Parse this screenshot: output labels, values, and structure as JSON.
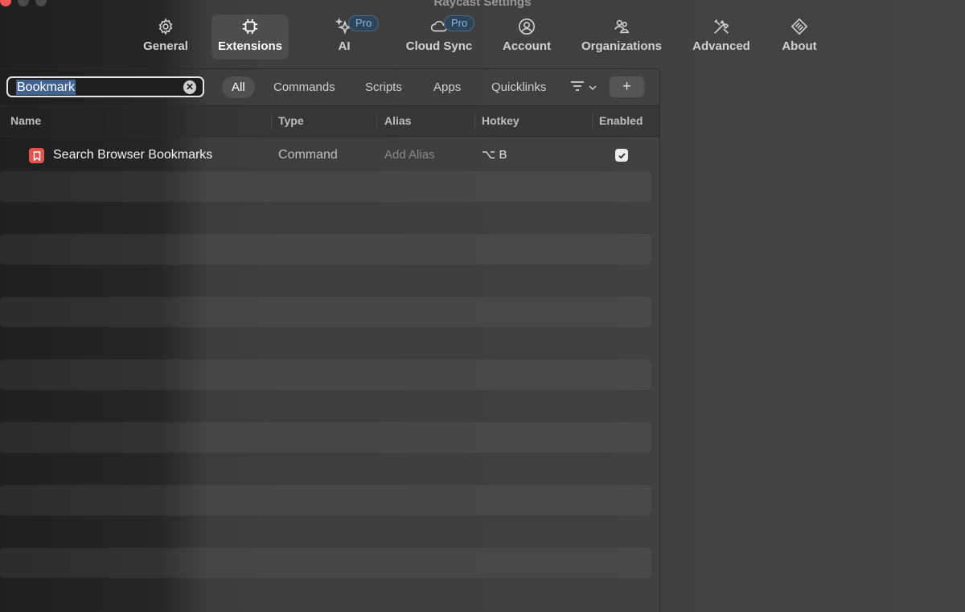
{
  "window": {
    "title": "Raycast Settings"
  },
  "tabs": [
    {
      "label": "General",
      "icon": "gear-icon"
    },
    {
      "label": "Extensions",
      "icon": "chip-icon",
      "active": true
    },
    {
      "label": "AI",
      "icon": "sparkle-icon",
      "badge": "Pro"
    },
    {
      "label": "Cloud Sync",
      "icon": "cloud-icon",
      "badge": "Pro"
    },
    {
      "label": "Account",
      "icon": "person-icon"
    },
    {
      "label": "Organizations",
      "icon": "people-icon"
    },
    {
      "label": "Advanced",
      "icon": "tools-icon"
    },
    {
      "label": "About",
      "icon": "raycast-logo-icon"
    }
  ],
  "search": {
    "value": "Bookmark"
  },
  "filters": [
    "All",
    "Commands",
    "Scripts",
    "Apps",
    "Quicklinks"
  ],
  "add_label": "+",
  "table": {
    "columns": [
      "Name",
      "Type",
      "Alias",
      "Hotkey",
      "Enabled"
    ],
    "rows": [
      {
        "name": "Search Browser Bookmarks",
        "icon": "bookmark-icon",
        "type": "Command",
        "alias_placeholder": "Add Alias",
        "hotkey": "⌥ B",
        "enabled": true
      }
    ]
  },
  "colors": {
    "accent_red": "#e2544f",
    "pro_badge": "#8ab8e6",
    "selection": "#41638f"
  }
}
